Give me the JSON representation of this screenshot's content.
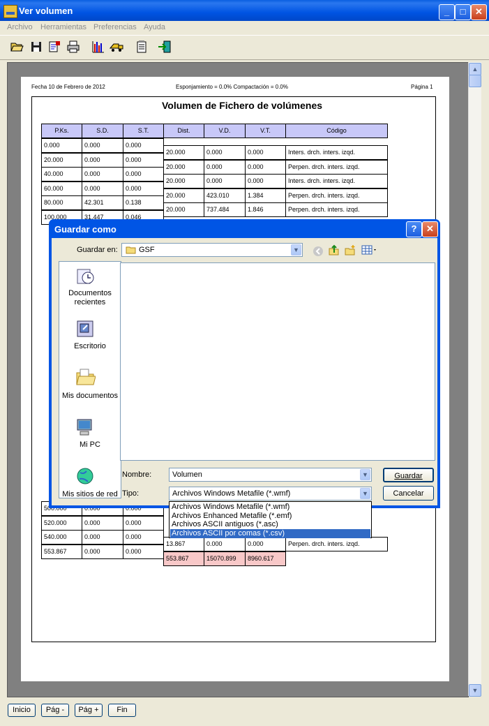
{
  "window": {
    "title": "Ver volumen",
    "menu": [
      "Archivo",
      "Herramientas",
      "Preferencias",
      "Ayuda"
    ]
  },
  "toolbar_icons": [
    "open-folder-icon",
    "save-icon",
    "properties-icon",
    "print-icon",
    "chart-icon",
    "truck-icon",
    "notepad-icon",
    "exit-icon"
  ],
  "report": {
    "date": "Fecha 10 de Febrero de 2012",
    "params": "Esponjamiento = 0.0% Compactación = 0.0%",
    "page": "Página 1",
    "title": "Volumen de Fichero de volúmenes",
    "left_headers": [
      "P.Ks.",
      "S.D.",
      "S.T."
    ],
    "right_headers": [
      "Dist.",
      "V.D.",
      "V.T.",
      "Código"
    ],
    "left_rows": [
      [
        "0.000",
        "0.000",
        "0.000"
      ],
      [
        "20.000",
        "0.000",
        "0.000"
      ],
      [
        "40.000",
        "0.000",
        "0.000"
      ],
      [
        "60.000",
        "0.000",
        "0.000"
      ],
      [
        "80.000",
        "42.301",
        "0.138"
      ],
      [
        "100.000",
        "31.447",
        "0.046"
      ]
    ],
    "right_rows": [
      [
        "20.000",
        "0.000",
        "0.000",
        "Inters. drch. inters. izqd."
      ],
      [
        "20.000",
        "0.000",
        "0.000",
        "Perpen. drch. inters. izqd."
      ],
      [
        "20.000",
        "0.000",
        "0.000",
        "Inters. drch. inters. izqd."
      ],
      [
        "20.000",
        "423.010",
        "1.384",
        "Perpen. drch. inters. izqd."
      ],
      [
        "20.000",
        "737.484",
        "1.846",
        "Perpen. drch. inters. izqd."
      ]
    ],
    "left_rows_bottom": [
      [
        "500.000",
        "0.000",
        "0.000"
      ],
      [
        "520.000",
        "0.000",
        "0.000"
      ],
      [
        "540.000",
        "0.000",
        "0.000"
      ],
      [
        "553.867",
        "0.000",
        "0.000"
      ]
    ],
    "right_rows_bottom": [
      [
        "13.867",
        "0.000",
        "0.000",
        "Perpen. drch. inters. izqd."
      ]
    ],
    "totals": [
      "553.867",
      "15070.899",
      "8960.617"
    ]
  },
  "dialog": {
    "title": "Guardar como",
    "save_in_label": "Guardar en:",
    "save_in_value": "GSF",
    "places": [
      "Documentos recientes",
      "Escritorio",
      "Mis documentos",
      "Mi PC",
      "Mis sitios de red"
    ],
    "filename_label": "Nombre:",
    "filename_value": "Volumen",
    "type_label": "Tipo:",
    "type_value": "Archivos Windows Metafile (*.wmf)",
    "type_options": [
      "Archivos Windows Metafile (*.wmf)",
      "Archivos Enhanced Metafile (*.emf)",
      "Archivos ASCII antiguos (*.asc)",
      "Archivos ASCII por comas (*.csv)"
    ],
    "selected_option": "Archivos ASCII por comas (*.csv)",
    "save_button": "Guardar",
    "cancel_button": "Cancelar",
    "help": "?"
  },
  "nav": {
    "first": "Inicio",
    "prev": "Pág -",
    "next": "Pág +",
    "last": "Fin"
  }
}
